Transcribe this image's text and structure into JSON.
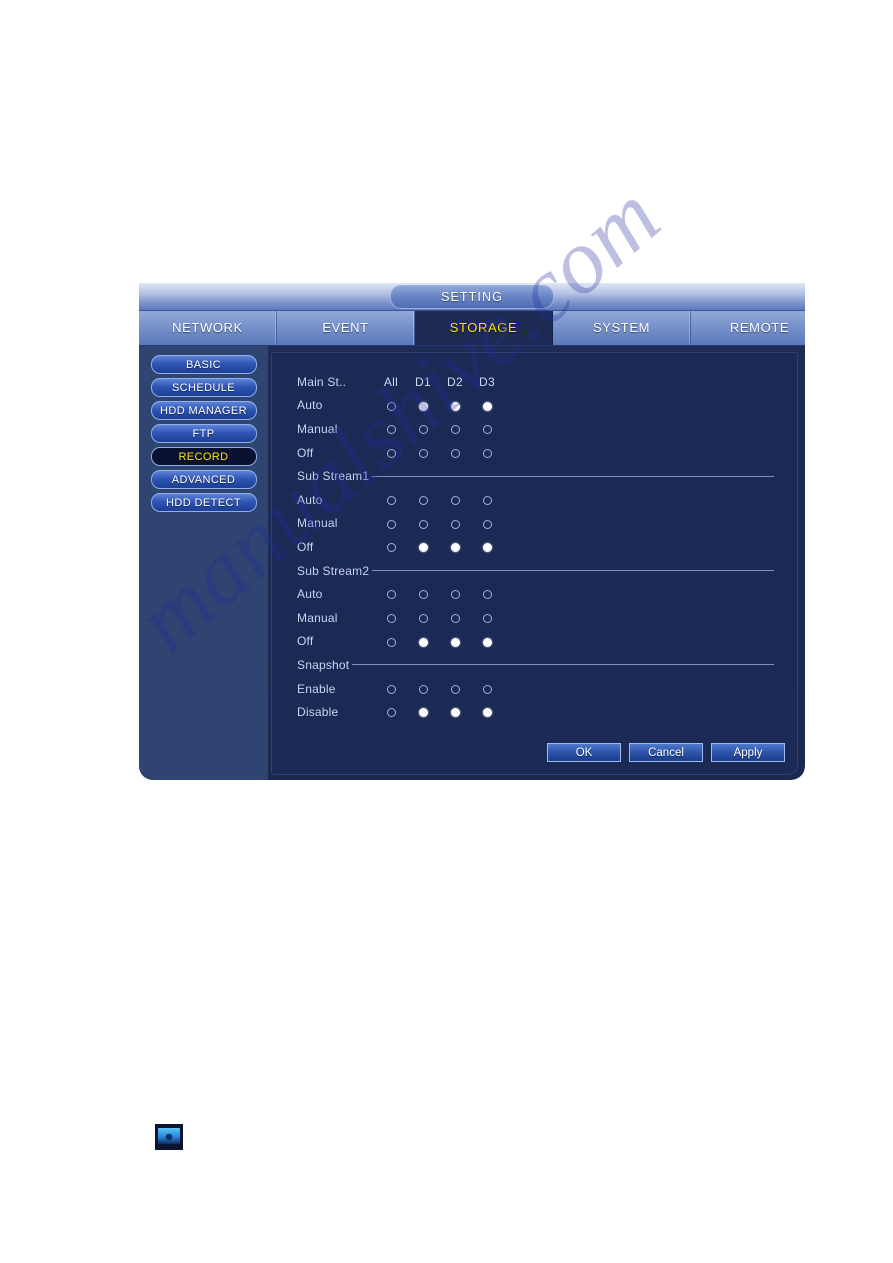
{
  "window": {
    "title": "SETTING",
    "tabs": [
      {
        "label": "NETWORK",
        "active": false
      },
      {
        "label": "EVENT",
        "active": false
      },
      {
        "label": "STORAGE",
        "active": true
      },
      {
        "label": "SYSTEM",
        "active": false
      },
      {
        "label": "REMOTE",
        "active": false
      },
      {
        "label": "",
        "active": false
      }
    ]
  },
  "sidebar": {
    "items": [
      {
        "label": "BASIC",
        "active": false
      },
      {
        "label": "SCHEDULE",
        "active": false
      },
      {
        "label": "HDD MANAGER",
        "active": false
      },
      {
        "label": "FTP",
        "active": false
      },
      {
        "label": "RECORD",
        "active": true
      },
      {
        "label": "ADVANCED",
        "active": false
      },
      {
        "label": "HDD DETECT",
        "active": false
      }
    ]
  },
  "record": {
    "columns": [
      "All",
      "D1",
      "D2",
      "D3"
    ],
    "sections": [
      {
        "title": "Main St..",
        "is_header_row": true,
        "rows": [
          {
            "label": "Auto",
            "values": [
              false,
              true,
              true,
              true
            ]
          },
          {
            "label": "Manual",
            "values": [
              false,
              false,
              false,
              false
            ]
          },
          {
            "label": "Off",
            "values": [
              false,
              false,
              false,
              false
            ]
          }
        ]
      },
      {
        "title": "Sub Stream1",
        "is_header_row": false,
        "rows": [
          {
            "label": "Auto",
            "values": [
              false,
              false,
              false,
              false
            ]
          },
          {
            "label": "Manual",
            "values": [
              false,
              false,
              false,
              false
            ]
          },
          {
            "label": "Off",
            "values": [
              false,
              true,
              true,
              true
            ]
          }
        ]
      },
      {
        "title": "Sub Stream2",
        "is_header_row": false,
        "rows": [
          {
            "label": "Auto",
            "values": [
              false,
              false,
              false,
              false
            ]
          },
          {
            "label": "Manual",
            "values": [
              false,
              false,
              false,
              false
            ]
          },
          {
            "label": "Off",
            "values": [
              false,
              true,
              true,
              true
            ]
          }
        ]
      },
      {
        "title": "Snapshot",
        "is_header_row": false,
        "rows": [
          {
            "label": "Enable",
            "values": [
              false,
              false,
              false,
              false
            ]
          },
          {
            "label": "Disable",
            "values": [
              false,
              true,
              true,
              true
            ]
          }
        ]
      }
    ]
  },
  "buttons": [
    {
      "label": "OK",
      "name": "ok-button"
    },
    {
      "label": "Cancel",
      "name": "cancel-button"
    },
    {
      "label": "Apply",
      "name": "apply-button"
    }
  ],
  "watermark": {
    "text": "manualshive.com"
  },
  "colors": {
    "accent_yellow": "#ffe200",
    "panel_navy": "#1b2a55",
    "sidebar_blue": "#2f4470",
    "tab_blue": "#7490c9",
    "label_text": "#c6d4ef"
  }
}
